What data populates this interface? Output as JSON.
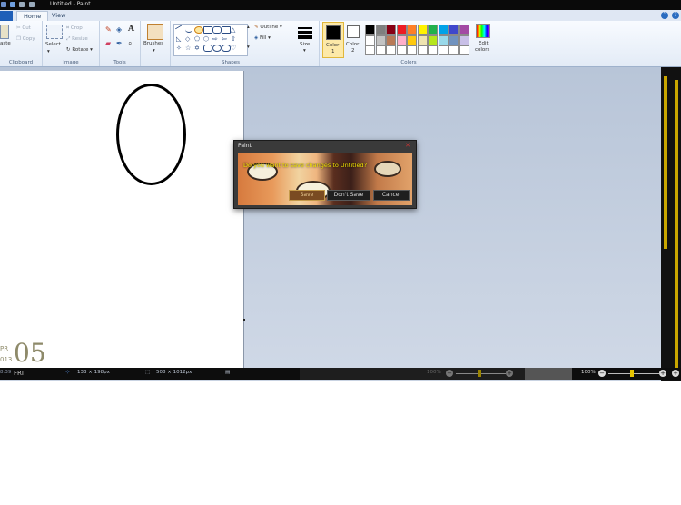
{
  "window": {
    "title": "Untitled - Paint"
  },
  "tabs": [
    {
      "label": "Home"
    },
    {
      "label": "View"
    }
  ],
  "ribbon": {
    "clipboard": {
      "group_label": "Clipboard",
      "cut": "Cut",
      "copy": "Copy",
      "paste": "aste"
    },
    "image": {
      "group_label": "Image",
      "select": "Select",
      "crop": "Crop",
      "resize": "Resize",
      "rotate": "Rotate"
    },
    "tools": {
      "group_label": "Tools"
    },
    "brushes": {
      "label": "Brushes"
    },
    "shapes": {
      "group_label": "Shapes",
      "outline": "Outline",
      "fill": "Fill"
    },
    "size": {
      "label": "Size"
    },
    "color1": {
      "label": "Color",
      "num": "1"
    },
    "color2": {
      "label": "Color",
      "num": "2"
    },
    "colors": {
      "group_label": "Colors",
      "edit_label": "Edit",
      "edit_label2": "colors"
    }
  },
  "palette_row1": [
    "#000000",
    "#7f7f7f",
    "#880015",
    "#ed1c24",
    "#ff7f27",
    "#fff200",
    "#22b14c",
    "#00a2e8",
    "#3f48cc",
    "#a349a4"
  ],
  "palette_row2": [
    "#ffffff",
    "#c3c3c3",
    "#b97a57",
    "#ffaec9",
    "#ffc90e",
    "#efe4b0",
    "#b5e61d",
    "#99d9ea",
    "#7092be",
    "#c8bfe7"
  ],
  "dialog": {
    "title": "Paint",
    "message": "Do you want to save changes to Untitled?",
    "buttons": {
      "save": "Save",
      "dont_save": "Don't Save",
      "cancel": "Cancel"
    }
  },
  "clock": {
    "month": "PR",
    "year": "013",
    "day": "05",
    "dow": "FRI",
    "time": "8:39"
  },
  "status": {
    "cursor": "133 × 198px",
    "canvas_size": "508 × 1012px",
    "zoom_left": "100%",
    "zoom_right": "100%"
  }
}
